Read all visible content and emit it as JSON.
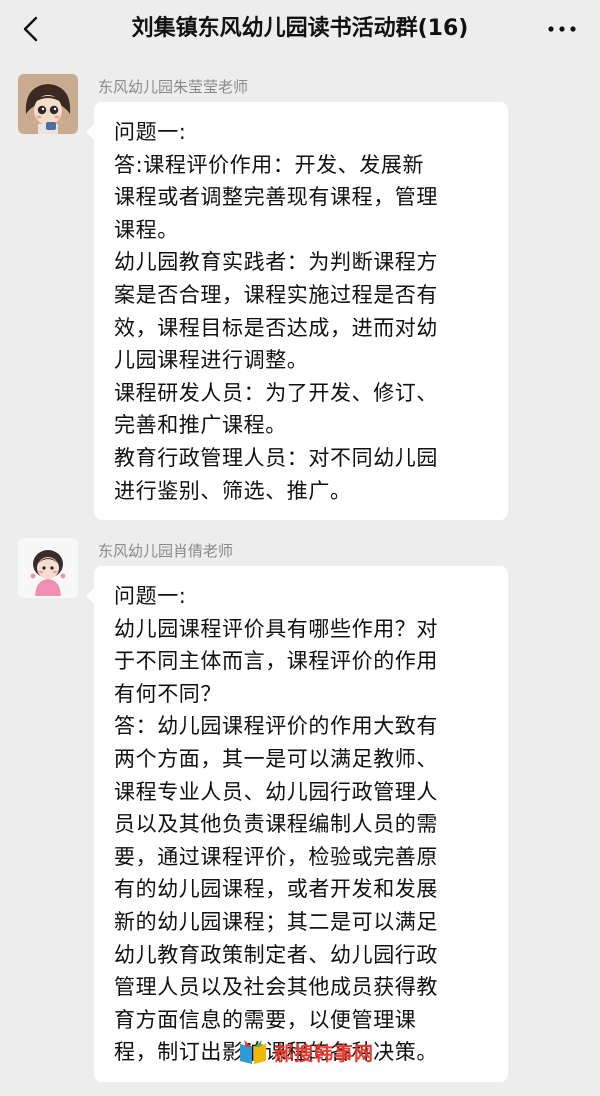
{
  "header": {
    "title": "刘集镇东风幼儿园读书活动群(16)",
    "back_icon": "chevron-left-icon",
    "more_icon": "more-dots-icon"
  },
  "messages": [
    {
      "sender": "东风幼儿园朱莹莹老师",
      "avatar_icon": "cartoon-girl-avatar",
      "lines": [
        "问题一:",
        "答:课程评价作用：开发、发展新",
        "课程或者调整完善现有课程，管理",
        "课程。",
        "幼儿园教育实践者：为判断课程方",
        "案是否合理，课程实施过程是否有",
        "效，课程目标是否达成，进而对幼",
        "儿园课程进行调整。",
        "课程研发人员：为了开发、修订、",
        "完善和推广课程。",
        "教育行政管理人员：对不同幼儿园",
        "进行鉴别、筛选、推广。"
      ]
    },
    {
      "sender": "东风幼儿园肖倩老师",
      "avatar_icon": "cartoon-girl-pink-avatar",
      "lines": [
        "问题一:",
        "幼儿园课程评价具有哪些作用？对",
        "于不同主体而言，课程评价的作用",
        "有何不同？",
        "答：幼儿园课程评价的作用大致有",
        "两个方面，其一是可以满足教师、",
        "课程专业人员、幼儿园行政管理人",
        "员以及其他负责课程编制人员的需",
        "要，通过课程评价，检验或完善原",
        "有的幼儿园课程，或者开发和发展",
        "新的幼儿园课程；其二是可以满足",
        "幼儿教育政策制定者、幼儿园行政",
        "管理人员以及社会其他成员获得教",
        "育方面信息的需要，以便管理课",
        "程，制订出影响课程的各种决策。"
      ]
    }
  ],
  "watermark": {
    "text": "郝搜韩事网",
    "icon": "book-logo-icon"
  },
  "colors": {
    "background": "#ededed",
    "bubble": "#ffffff",
    "sender": "#8a8a8a",
    "watermark": "#e63a2e"
  }
}
